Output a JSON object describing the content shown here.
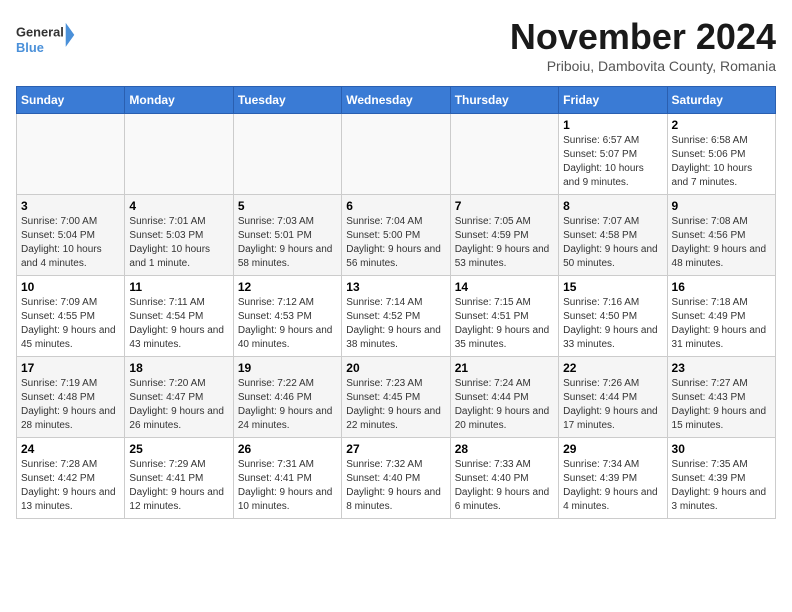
{
  "logo": {
    "line1": "General",
    "line2": "Blue"
  },
  "title": "November 2024",
  "subtitle": "Priboiu, Dambovita County, Romania",
  "days_of_week": [
    "Sunday",
    "Monday",
    "Tuesday",
    "Wednesday",
    "Thursday",
    "Friday",
    "Saturday"
  ],
  "weeks": [
    [
      {
        "num": "",
        "info": ""
      },
      {
        "num": "",
        "info": ""
      },
      {
        "num": "",
        "info": ""
      },
      {
        "num": "",
        "info": ""
      },
      {
        "num": "",
        "info": ""
      },
      {
        "num": "1",
        "info": "Sunrise: 6:57 AM\nSunset: 5:07 PM\nDaylight: 10 hours and 9 minutes."
      },
      {
        "num": "2",
        "info": "Sunrise: 6:58 AM\nSunset: 5:06 PM\nDaylight: 10 hours and 7 minutes."
      }
    ],
    [
      {
        "num": "3",
        "info": "Sunrise: 7:00 AM\nSunset: 5:04 PM\nDaylight: 10 hours and 4 minutes."
      },
      {
        "num": "4",
        "info": "Sunrise: 7:01 AM\nSunset: 5:03 PM\nDaylight: 10 hours and 1 minute."
      },
      {
        "num": "5",
        "info": "Sunrise: 7:03 AM\nSunset: 5:01 PM\nDaylight: 9 hours and 58 minutes."
      },
      {
        "num": "6",
        "info": "Sunrise: 7:04 AM\nSunset: 5:00 PM\nDaylight: 9 hours and 56 minutes."
      },
      {
        "num": "7",
        "info": "Sunrise: 7:05 AM\nSunset: 4:59 PM\nDaylight: 9 hours and 53 minutes."
      },
      {
        "num": "8",
        "info": "Sunrise: 7:07 AM\nSunset: 4:58 PM\nDaylight: 9 hours and 50 minutes."
      },
      {
        "num": "9",
        "info": "Sunrise: 7:08 AM\nSunset: 4:56 PM\nDaylight: 9 hours and 48 minutes."
      }
    ],
    [
      {
        "num": "10",
        "info": "Sunrise: 7:09 AM\nSunset: 4:55 PM\nDaylight: 9 hours and 45 minutes."
      },
      {
        "num": "11",
        "info": "Sunrise: 7:11 AM\nSunset: 4:54 PM\nDaylight: 9 hours and 43 minutes."
      },
      {
        "num": "12",
        "info": "Sunrise: 7:12 AM\nSunset: 4:53 PM\nDaylight: 9 hours and 40 minutes."
      },
      {
        "num": "13",
        "info": "Sunrise: 7:14 AM\nSunset: 4:52 PM\nDaylight: 9 hours and 38 minutes."
      },
      {
        "num": "14",
        "info": "Sunrise: 7:15 AM\nSunset: 4:51 PM\nDaylight: 9 hours and 35 minutes."
      },
      {
        "num": "15",
        "info": "Sunrise: 7:16 AM\nSunset: 4:50 PM\nDaylight: 9 hours and 33 minutes."
      },
      {
        "num": "16",
        "info": "Sunrise: 7:18 AM\nSunset: 4:49 PM\nDaylight: 9 hours and 31 minutes."
      }
    ],
    [
      {
        "num": "17",
        "info": "Sunrise: 7:19 AM\nSunset: 4:48 PM\nDaylight: 9 hours and 28 minutes."
      },
      {
        "num": "18",
        "info": "Sunrise: 7:20 AM\nSunset: 4:47 PM\nDaylight: 9 hours and 26 minutes."
      },
      {
        "num": "19",
        "info": "Sunrise: 7:22 AM\nSunset: 4:46 PM\nDaylight: 9 hours and 24 minutes."
      },
      {
        "num": "20",
        "info": "Sunrise: 7:23 AM\nSunset: 4:45 PM\nDaylight: 9 hours and 22 minutes."
      },
      {
        "num": "21",
        "info": "Sunrise: 7:24 AM\nSunset: 4:44 PM\nDaylight: 9 hours and 20 minutes."
      },
      {
        "num": "22",
        "info": "Sunrise: 7:26 AM\nSunset: 4:44 PM\nDaylight: 9 hours and 17 minutes."
      },
      {
        "num": "23",
        "info": "Sunrise: 7:27 AM\nSunset: 4:43 PM\nDaylight: 9 hours and 15 minutes."
      }
    ],
    [
      {
        "num": "24",
        "info": "Sunrise: 7:28 AM\nSunset: 4:42 PM\nDaylight: 9 hours and 13 minutes."
      },
      {
        "num": "25",
        "info": "Sunrise: 7:29 AM\nSunset: 4:41 PM\nDaylight: 9 hours and 12 minutes."
      },
      {
        "num": "26",
        "info": "Sunrise: 7:31 AM\nSunset: 4:41 PM\nDaylight: 9 hours and 10 minutes."
      },
      {
        "num": "27",
        "info": "Sunrise: 7:32 AM\nSunset: 4:40 PM\nDaylight: 9 hours and 8 minutes."
      },
      {
        "num": "28",
        "info": "Sunrise: 7:33 AM\nSunset: 4:40 PM\nDaylight: 9 hours and 6 minutes."
      },
      {
        "num": "29",
        "info": "Sunrise: 7:34 AM\nSunset: 4:39 PM\nDaylight: 9 hours and 4 minutes."
      },
      {
        "num": "30",
        "info": "Sunrise: 7:35 AM\nSunset: 4:39 PM\nDaylight: 9 hours and 3 minutes."
      }
    ]
  ]
}
